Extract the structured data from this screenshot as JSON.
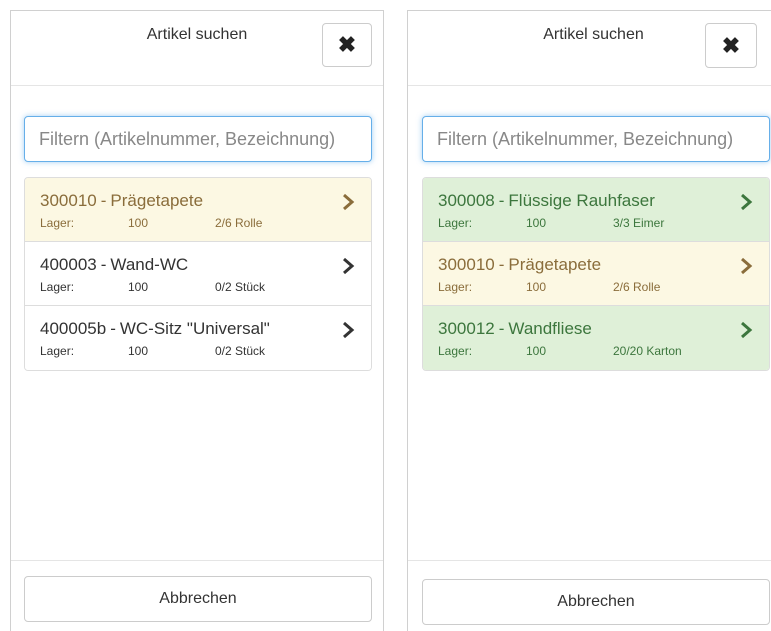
{
  "dialogs": [
    {
      "title": "Artikel suchen",
      "close_label": "✖",
      "search": {
        "placeholder": "Filtern (Artikelnummer, Bezeichnung)",
        "value": ""
      },
      "cancel_label": "Abbrechen",
      "items": [
        {
          "number": "300010",
          "sep": "-",
          "name": "Prägetapete",
          "stock_label": "Lager:",
          "stock": "100",
          "qty": "2/6 Rolle",
          "state": "warning"
        },
        {
          "number": "400003",
          "sep": "-",
          "name": "Wand-WC",
          "stock_label": "Lager:",
          "stock": "100",
          "qty": "0/2 Stück",
          "state": "default"
        },
        {
          "number": "400005b",
          "sep": "-",
          "name": "WC-Sitz \"Universal\"",
          "stock_label": "Lager:",
          "stock": "100",
          "qty": "0/2 Stück",
          "state": "default"
        }
      ]
    },
    {
      "title": "Artikel suchen",
      "close_label": "✖",
      "search": {
        "placeholder": "Filtern (Artikelnummer, Bezeichnung)",
        "value": ""
      },
      "cancel_label": "Abbrechen",
      "items": [
        {
          "number": "300008",
          "sep": "-",
          "name": "Flüssige Rauhfaser",
          "stock_label": "Lager:",
          "stock": "100",
          "qty": "3/3 Eimer",
          "state": "success"
        },
        {
          "number": "300010",
          "sep": "-",
          "name": "Prägetapete",
          "stock_label": "Lager:",
          "stock": "100",
          "qty": "2/6 Rolle",
          "state": "warning"
        },
        {
          "number": "300012",
          "sep": "-",
          "name": "Wandfliese",
          "stock_label": "Lager:",
          "stock": "100",
          "qty": "20/20 Karton",
          "state": "success"
        }
      ]
    }
  ],
  "colors": {
    "warning_bg": "#fcf8e3",
    "warning_text": "#8a6d3b",
    "success_bg": "#dff0d8",
    "success_text": "#3c763d",
    "input_focus": "#66afe9"
  },
  "icons": {
    "close": "close-icon",
    "chevron": "chevron-right-icon"
  }
}
